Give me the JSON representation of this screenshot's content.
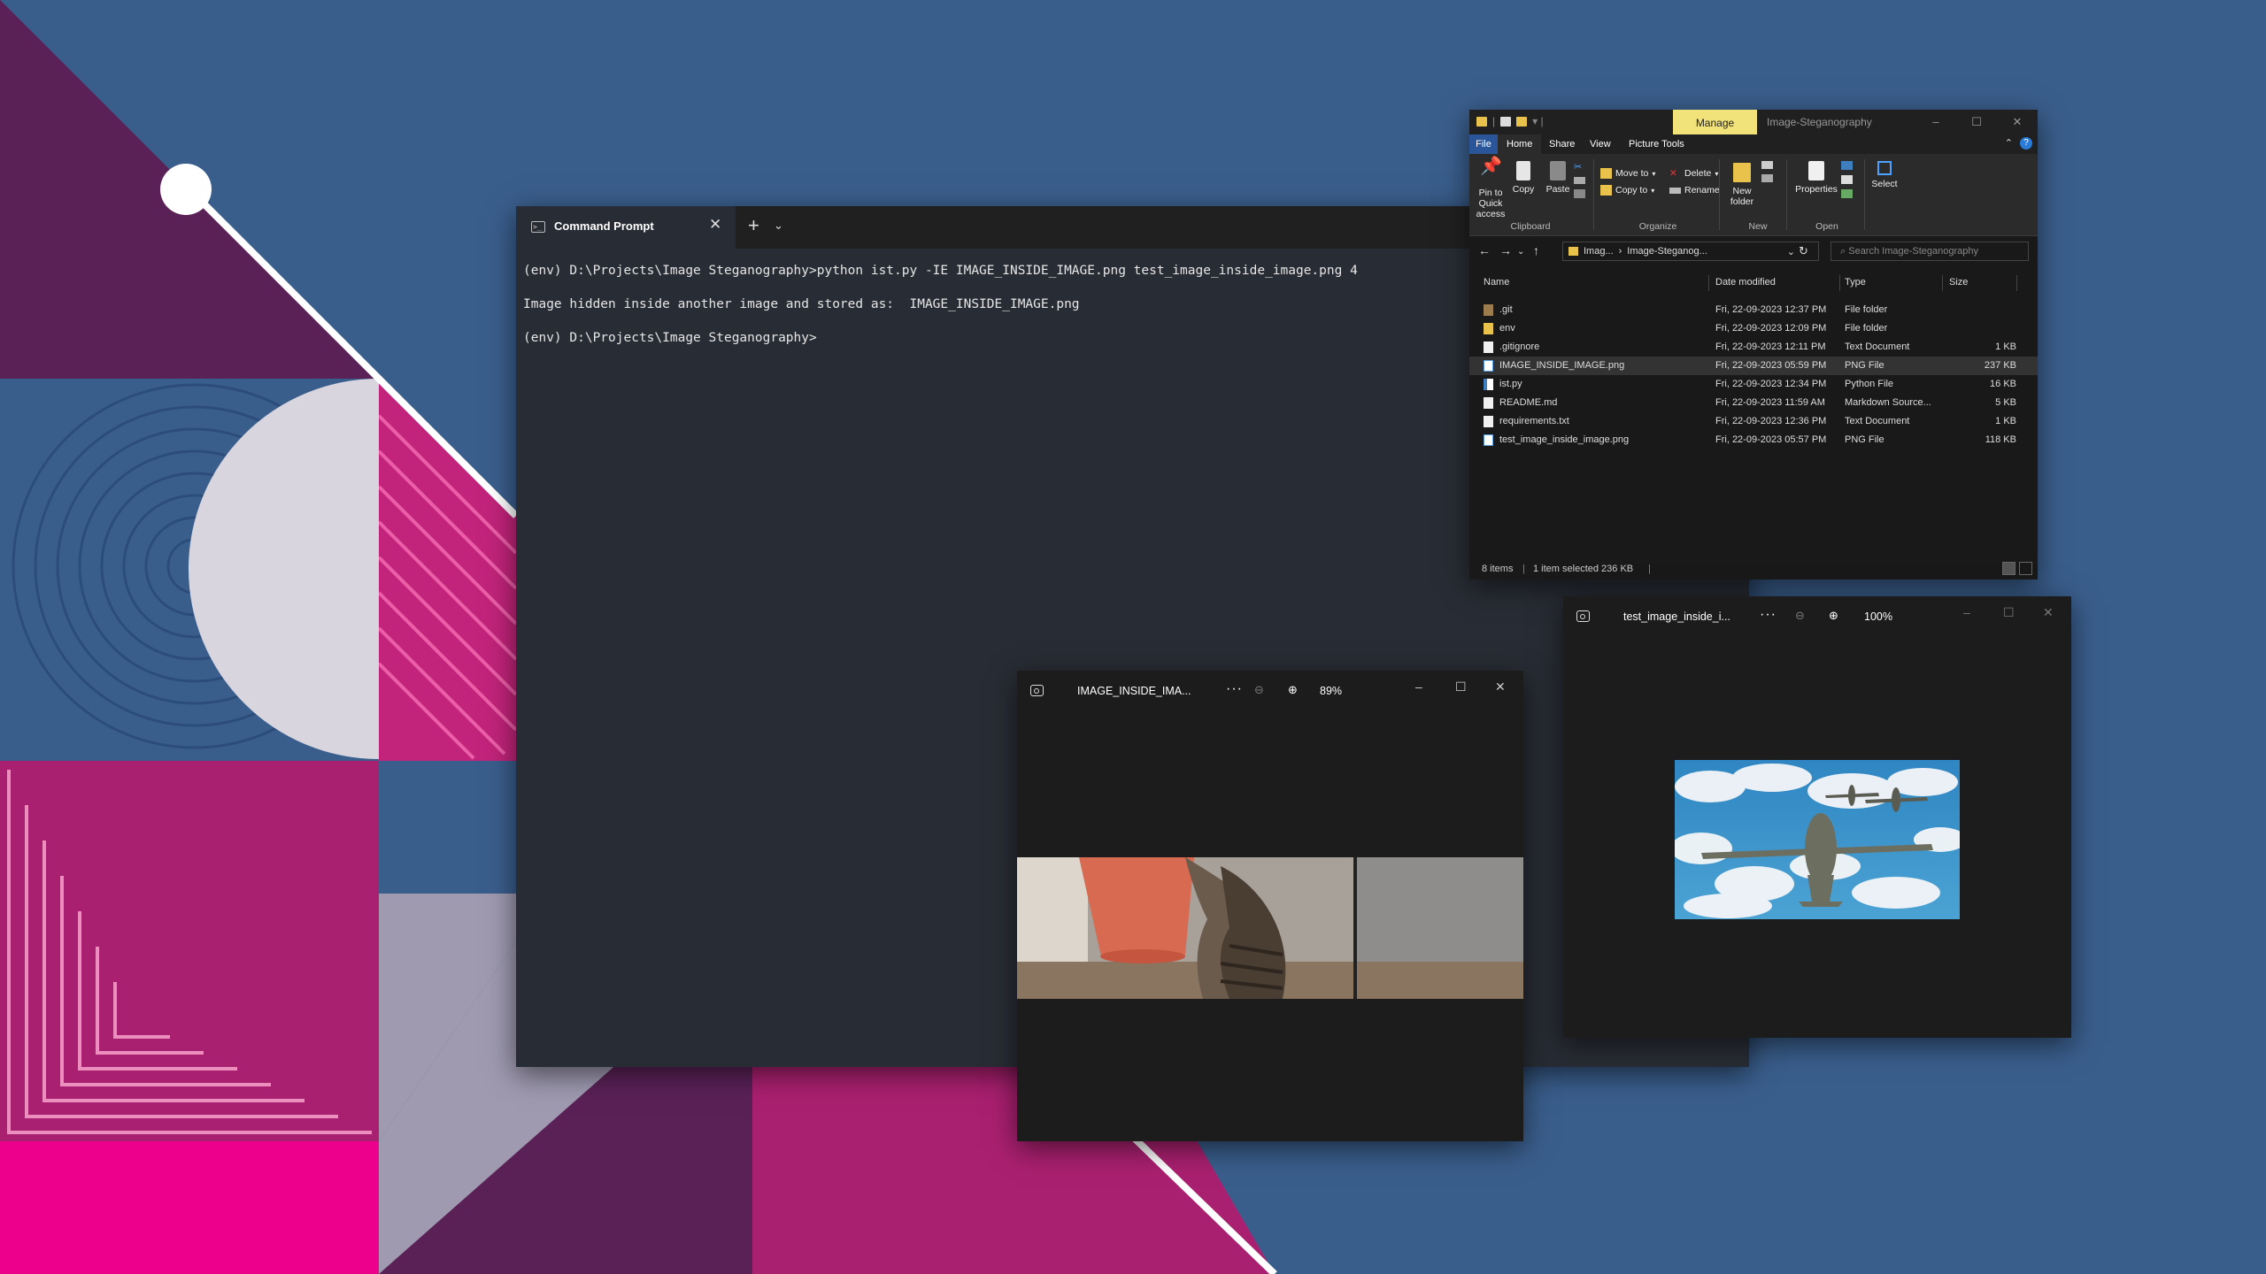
{
  "terminal": {
    "tab_title": "Command Prompt",
    "tab_close": "✕",
    "new_tab": "+",
    "tab_menu": "⌄",
    "lines": [
      "(env) D:\\Projects\\Image Steganography>python ist.py -IE IMAGE_INSIDE_IMAGE.png test_image_inside_image.png 4",
      "Image hidden inside another image and stored as:  IMAGE_INSIDE_IMAGE.png",
      "(env) D:\\Projects\\Image Steganography>"
    ]
  },
  "explorer": {
    "manage_tab": "Manage",
    "title": "Image-Steganography",
    "caption": {
      "min": "–",
      "max": "☐",
      "close": "✕"
    },
    "tabs": {
      "file": "File",
      "home": "Home",
      "share": "Share",
      "view": "View",
      "picture_tools": "Picture Tools"
    },
    "ribbon": {
      "pin": "Pin to Quick access",
      "copy": "Copy",
      "paste": "Paste",
      "move_to": "Move to",
      "copy_to": "Copy to",
      "delete": "Delete",
      "rename": "Rename",
      "new_folder": "New folder",
      "properties": "Properties",
      "select": "Select",
      "groups": {
        "clipboard": "Clipboard",
        "organize": "Organize",
        "new": "New",
        "open": "Open"
      }
    },
    "address": {
      "crumb1": "Imag...",
      "sep": "›",
      "crumb2": "Image-Steganog...",
      "chevron": "⌄",
      "refresh": "↻"
    },
    "search_placeholder": "Search Image-Steganography",
    "columns": {
      "name": "Name",
      "date": "Date modified",
      "type": "Type",
      "size": "Size"
    },
    "files": [
      {
        "name": ".git",
        "date": "Fri, 22-09-2023 12:37 PM",
        "type": "File folder",
        "size": ""
      },
      {
        "name": "env",
        "date": "Fri, 22-09-2023 12:09 PM",
        "type": "File folder",
        "size": ""
      },
      {
        "name": ".gitignore",
        "date": "Fri, 22-09-2023 12:11 PM",
        "type": "Text Document",
        "size": "1 KB"
      },
      {
        "name": "IMAGE_INSIDE_IMAGE.png",
        "date": "Fri, 22-09-2023 05:59 PM",
        "type": "PNG File",
        "size": "237 KB"
      },
      {
        "name": "ist.py",
        "date": "Fri, 22-09-2023 12:34 PM",
        "type": "Python File",
        "size": "16 KB"
      },
      {
        "name": "README.md",
        "date": "Fri, 22-09-2023 11:59 AM",
        "type": "Markdown Source...",
        "size": "5 KB"
      },
      {
        "name": "requirements.txt",
        "date": "Fri, 22-09-2023 12:36 PM",
        "type": "Text Document",
        "size": "1 KB"
      },
      {
        "name": "test_image_inside_image.png",
        "date": "Fri, 22-09-2023 05:57 PM",
        "type": "PNG File",
        "size": "118 KB"
      }
    ],
    "status": {
      "count": "8 items",
      "selected": "1 item selected  236 KB"
    }
  },
  "photos1": {
    "filename": "IMAGE_INSIDE_IMA...",
    "more": "···",
    "zoom": "89%"
  },
  "photos2": {
    "filename": "test_image_inside_i...",
    "more": "···",
    "zoom": "100%"
  },
  "colors": {
    "desktop": "#3a5e8c",
    "accent": "#2a5599",
    "manage": "#f2e27a",
    "magenta": "#ec008c",
    "plum": "#5a2157"
  }
}
